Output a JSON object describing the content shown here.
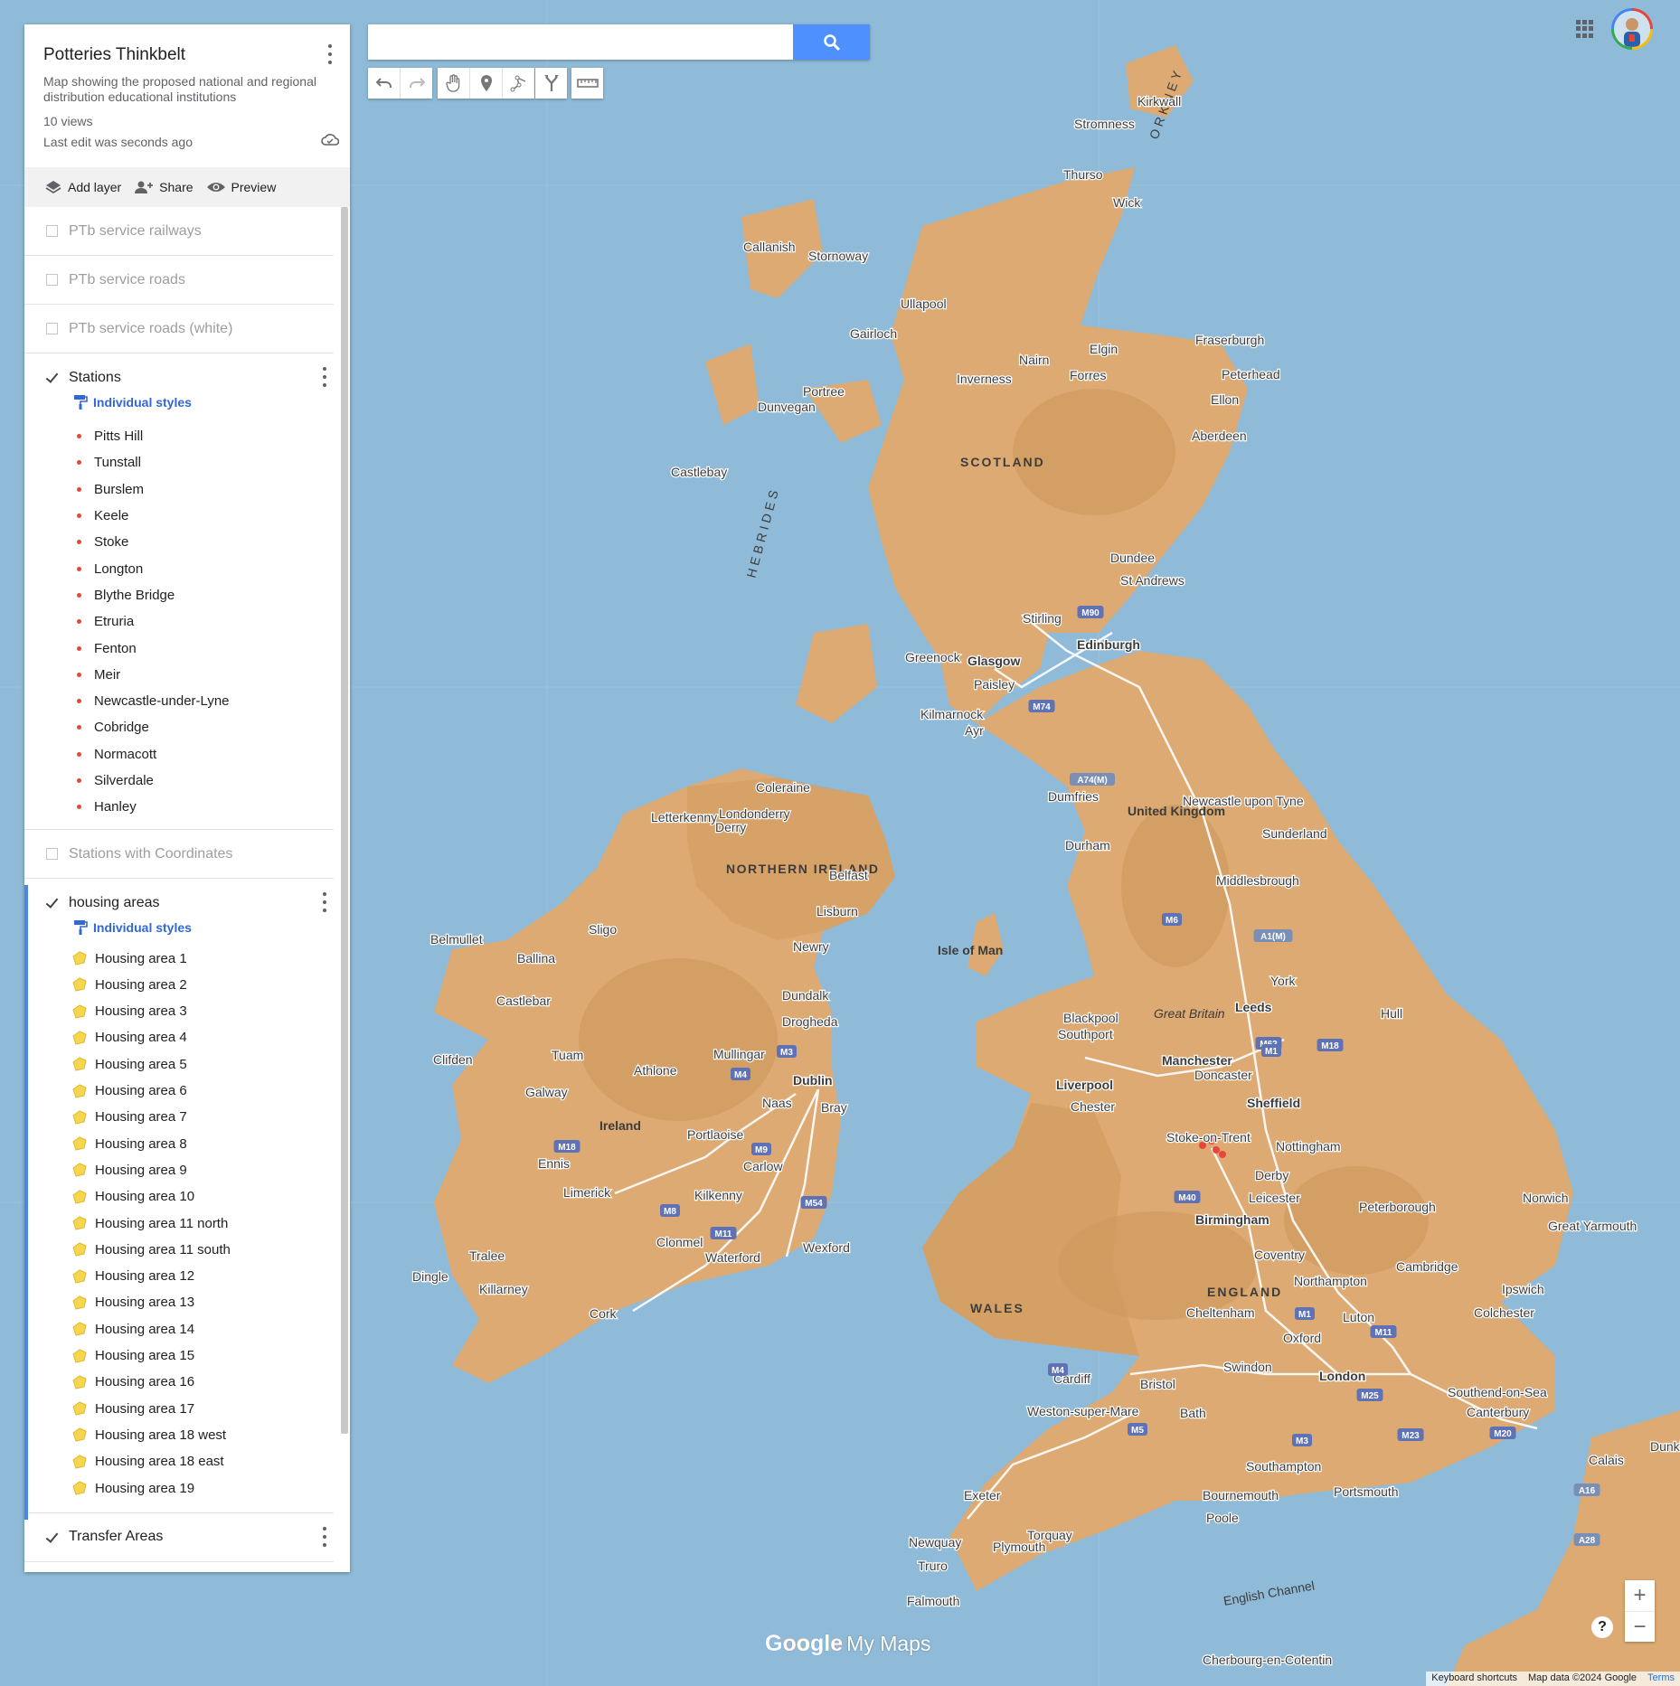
{
  "map": {
    "labels": {
      "scotland": "SCOTLAND",
      "united_kingdom": "United Kingdom",
      "northern_ireland": "NORTHERN IRELAND",
      "ireland": "Ireland",
      "isle_of_man": "Isle of Man",
      "wales": "WALES",
      "england": "ENGLAND",
      "hebrides": "HEBRIDES",
      "orkney": "ORKNEY",
      "english_channel": "English Channel",
      "great_britain": "Great Britain"
    },
    "cities": [
      "Kirkwall",
      "Stromness",
      "Thurso",
      "Wick",
      "Callanish",
      "Stornoway",
      "Ullapool",
      "Gairloch",
      "Portree",
      "Dunvegan",
      "Castlebay",
      "Inverness",
      "Nairn",
      "Elgin",
      "Forres",
      "Fraserburgh",
      "Peterhead",
      "Ellon",
      "Aberdeen",
      "Dundee",
      "St Andrews",
      "Stirling",
      "Edinburgh",
      "Glasgow",
      "Greenock",
      "Paisley",
      "Kilmarnock",
      "Ayr",
      "Dumfries",
      "Newcastle upon Tyne",
      "Sunderland",
      "Durham",
      "Middlesbrough",
      "Coleraine",
      "Londonderry",
      "Derry",
      "Letterkenny",
      "Belfast",
      "Lisburn",
      "Newry",
      "Sligo",
      "Belmullet",
      "Ballina",
      "Castlebar",
      "Dundalk",
      "Drogheda",
      "Clifden",
      "Tuam",
      "Mullingar",
      "Athlone",
      "Galway",
      "Dublin",
      "Naas",
      "Bray",
      "Ennis",
      "Portlaoise",
      "Carlow",
      "Limerick",
      "Kilkenny",
      "Clonmel",
      "Waterford",
      "Wexford",
      "Tralee",
      "Killarney",
      "Dingle",
      "Cork",
      "York",
      "Hull",
      "Leeds",
      "Blackpool",
      "Southport",
      "Manchester",
      "Liverpool",
      "Doncaster",
      "Sheffield",
      "Chester",
      "Stoke-on-Trent",
      "Nottingham",
      "Derby",
      "Leicester",
      "Peterborough",
      "Norwich",
      "Great Yarmouth",
      "Birmingham",
      "Coventry",
      "Cambridge",
      "Northampton",
      "Ipswich",
      "Cheltenham",
      "Luton",
      "Oxford",
      "Colchester",
      "Cardiff",
      "Bristol",
      "Swindon",
      "London",
      "Southend-on-Sea",
      "Weston-super-Mare",
      "Bath",
      "Canterbury",
      "Southampton",
      "Portsmouth",
      "Bournemouth",
      "Poole",
      "Exeter",
      "Torquay",
      "Plymouth",
      "Newquay",
      "Truro",
      "Falmouth",
      "Calais",
      "Dunkirk",
      "Cherbourg-en-Cotentin"
    ],
    "road_badges": [
      "M90",
      "M74",
      "A74(M)",
      "M6",
      "A1(M)",
      "M62",
      "M1",
      "M18",
      "M3",
      "M4",
      "M18",
      "M9",
      "M8",
      "M11",
      "M54",
      "M40",
      "M1",
      "M11",
      "M4",
      "M25",
      "M5",
      "M3",
      "M23",
      "M20",
      "A16",
      "A28"
    ]
  },
  "panel": {
    "title": "Potteries Thinkbelt",
    "description": "Map showing the proposed national and regional distribution educational institutions",
    "views": "10 views",
    "last_edit": "Last edit was seconds ago",
    "actions": {
      "add_layer": "Add layer",
      "share": "Share",
      "preview": "Preview"
    },
    "layers": {
      "railways": {
        "name": "PTb service railways",
        "checked": false
      },
      "roads": {
        "name": "PTb service roads",
        "checked": false
      },
      "roads_white": {
        "name": "PTb service roads (white)",
        "checked": false
      },
      "stations": {
        "name": "Stations",
        "checked": true,
        "style_label": "Individual styles",
        "items": [
          "Pitts Hill",
          "Tunstall",
          "Burslem",
          "Keele",
          "Stoke",
          "Longton",
          "Blythe Bridge",
          "Etruria",
          "Fenton",
          "Meir",
          "Newcastle-under-Lyne",
          "Cobridge",
          "Normacott",
          "Silverdale",
          "Hanley"
        ]
      },
      "stations_coords": {
        "name": "Stations with Coordinates",
        "checked": false
      },
      "housing": {
        "name": "housing areas",
        "checked": true,
        "style_label": "Individual styles",
        "items": [
          "Housing area 1",
          "Housing area 2",
          "Housing area 3",
          "Housing area 4",
          "Housing area 5",
          "Housing area 6",
          "Housing area 7",
          "Housing area 8",
          "Housing area 9",
          "Housing area 10",
          "Housing area 11 north",
          "Housing area 11 south",
          "Housing area 12",
          "Housing area 13",
          "Housing area 14",
          "Housing area 15",
          "Housing area 16",
          "Housing area 17",
          "Housing area 18 west",
          "Housing area 18 east",
          "Housing area 19"
        ]
      },
      "transfer": {
        "name": "Transfer Areas",
        "checked": true
      }
    }
  },
  "search": {
    "placeholder": "",
    "value": ""
  },
  "branding": {
    "google": "Google",
    "mymaps": "My Maps"
  },
  "footer": {
    "shortcuts": "Keyboard shortcuts",
    "mapdata": "Map data ©2024 Google",
    "terms": "Terms"
  },
  "zoom": {
    "in": "+",
    "out": "−"
  },
  "help": "?",
  "colors": {
    "water": "#8fbbd9",
    "land": "#dcaa72",
    "land_dark": "#cf9a5e",
    "accent": "#4d90fe",
    "station_dot": "#e8453c",
    "poly_fill": "#f7d64f"
  }
}
